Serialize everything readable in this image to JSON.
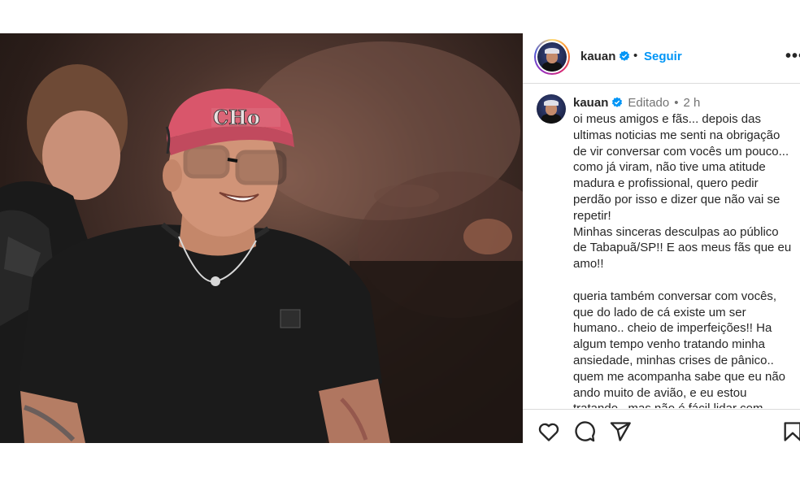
{
  "post": {
    "author": "kauan",
    "follow_label": "Seguir",
    "separator": "•",
    "more_label": "•••"
  },
  "caption": {
    "author": "kauan",
    "edited_label": "Editado",
    "separator": "•",
    "time_label": "2 h",
    "text": "oi meus amigos e fãs... depois das\nultimas noticias me senti na obrigação\nde vir conversar com vocês um pouco...\ncomo já viram, não tive uma atitude\nmadura e profissional, quero pedir\nperdão por isso e dizer que não vai se\nrepetir!\nMinhas sinceras desculpas ao público\nde Tabapuã/SP!! E aos meus fãs que eu\namo!!\n\nqueria também conversar com vocês,\nque do lado de cá existe um ser\nhumano.. cheio de imperfeições!! Ha\nalgum tempo venho tratando minha\nansiedade, minhas crises de pânico..\nquem me acompanha sabe que eu não\nando muito de avião, e eu estou\ntratando.. mas não é fácil lidar com"
  },
  "photo": {
    "cap_text": "CHo"
  },
  "icons": {
    "verified": "verified-badge-icon",
    "like": "heart-icon",
    "comment": "comment-icon",
    "share": "send-icon",
    "save": "bookmark-icon"
  },
  "colors": {
    "link_blue": "#0095f6",
    "verified_blue": "#0095f6",
    "text": "#262626",
    "muted": "#737373",
    "border": "#dbdbdb"
  }
}
